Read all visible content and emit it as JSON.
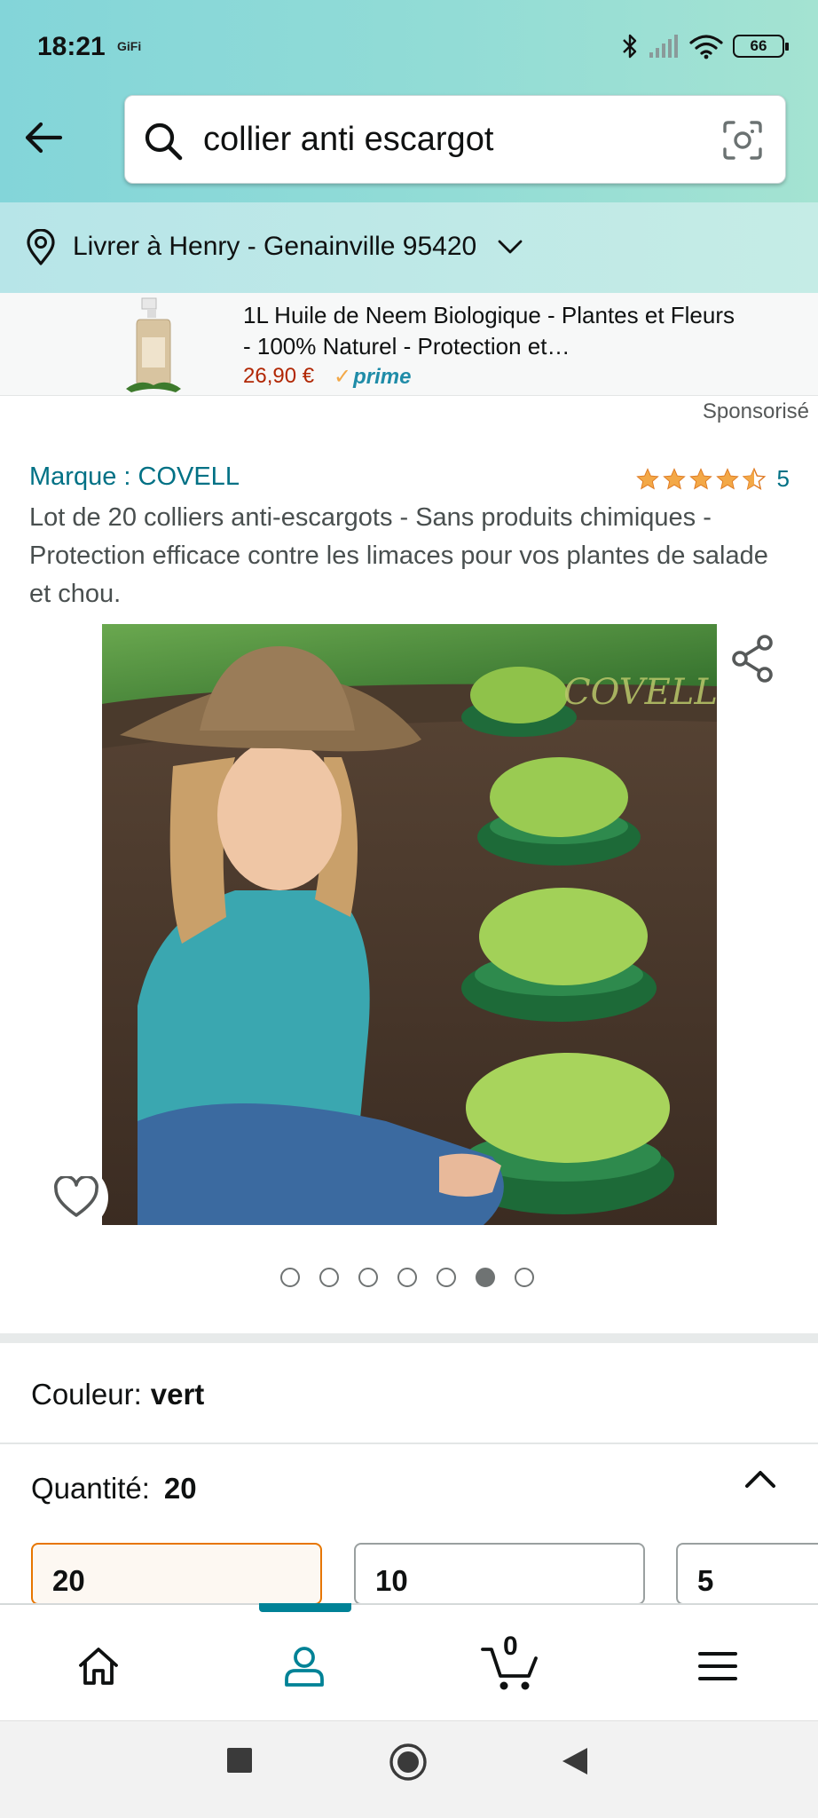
{
  "status_bar": {
    "time": "18:21",
    "notification_app": "GiFi",
    "battery": "66"
  },
  "search": {
    "query": "collier anti escargot"
  },
  "delivery": {
    "label": "Livrer à Henry - Genainville 95420"
  },
  "sponsored_ad": {
    "title": "1L Huile de Neem Biologique - Plantes et Fleurs - 100% Naturel - Protection et…",
    "price": "26,90 €",
    "prime": "prime",
    "sponsored_label": "Sponsorisé"
  },
  "product": {
    "brand": "Marque : COVELL",
    "rating": 4.5,
    "rating_count": "5",
    "title": "Lot de 20 colliers anti-escargots - Sans produits chimiques - Protection efficace contre les limaces pour vos plantes de salade et chou.",
    "image_watermark": "COVELL",
    "image_count": 7,
    "active_image_index": 5
  },
  "options": {
    "color_label": "Couleur:",
    "color_value": "vert",
    "quantity_label": "Quantité:",
    "quantity_value": "20",
    "quantity_choices": [
      "20",
      "10",
      "5"
    ]
  },
  "bottom_nav": {
    "items": [
      "home-icon",
      "account-icon",
      "cart-icon",
      "menu-icon"
    ],
    "cart_count": "0",
    "active_color": "#008296"
  },
  "colors": {
    "link": "#007185",
    "price": "#b12704",
    "star": "#f3a847",
    "selected_border": "#e77600"
  }
}
